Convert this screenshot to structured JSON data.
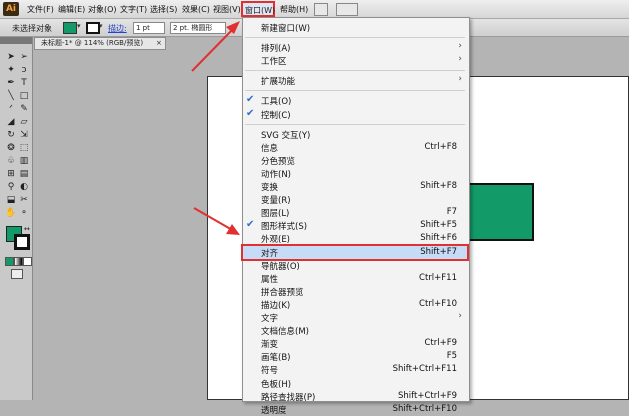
{
  "app": {
    "logo": "Ai"
  },
  "menubar": {
    "items": [
      "文件(F)",
      "编辑(E)",
      "对象(O)",
      "文字(T)",
      "选择(S)",
      "效果(C)",
      "视图(V)",
      "窗口(W)",
      "帮助(H)"
    ]
  },
  "controlbar": {
    "selection_status": "未选择对象",
    "stroke_label": "描边:",
    "stroke_weight": "1 pt",
    "brush": "2 pt. 椭圆形",
    "fill_color": "#139a69",
    "stroke_color": "#111111"
  },
  "document": {
    "tab_title": "未标题-1* @ 114% (RGB/预览)",
    "close_label": "×",
    "object_fill": "#139a69"
  },
  "window_menu": {
    "items": [
      {
        "label": "新建窗口(W)",
        "shortcut": "",
        "submenu": false,
        "checked": false
      },
      {
        "label": "排列(A)",
        "shortcut": "",
        "submenu": true,
        "checked": false
      },
      {
        "label": "工作区",
        "shortcut": "",
        "submenu": true,
        "checked": false
      },
      {
        "label": "扩展功能",
        "shortcut": "",
        "submenu": true,
        "checked": false
      },
      {
        "label": "工具(O)",
        "shortcut": "",
        "submenu": false,
        "checked": true
      },
      {
        "label": "控制(C)",
        "shortcut": "",
        "submenu": false,
        "checked": true
      },
      {
        "label": "SVG 交互(Y)",
        "shortcut": "",
        "submenu": false,
        "checked": false
      },
      {
        "label": "信息",
        "shortcut": "Ctrl+F8",
        "submenu": false,
        "checked": false
      },
      {
        "label": "分色预览",
        "shortcut": "",
        "submenu": false,
        "checked": false
      },
      {
        "label": "动作(N)",
        "shortcut": "",
        "submenu": false,
        "checked": false
      },
      {
        "label": "变换",
        "shortcut": "Shift+F8",
        "submenu": false,
        "checked": false
      },
      {
        "label": "变量(R)",
        "shortcut": "",
        "submenu": false,
        "checked": false
      },
      {
        "label": "图层(L)",
        "shortcut": "F7",
        "submenu": false,
        "checked": false
      },
      {
        "label": "图形样式(S)",
        "shortcut": "Shift+F5",
        "submenu": false,
        "checked": true
      },
      {
        "label": "外观(E)",
        "shortcut": "Shift+F6",
        "submenu": false,
        "checked": false
      },
      {
        "label": "对齐",
        "shortcut": "Shift+F7",
        "submenu": false,
        "checked": false,
        "highlighted": true
      },
      {
        "label": "导航器(O)",
        "shortcut": "",
        "submenu": false,
        "checked": false
      },
      {
        "label": "属性",
        "shortcut": "Ctrl+F11",
        "submenu": false,
        "checked": false
      },
      {
        "label": "拼合器预览",
        "shortcut": "",
        "submenu": false,
        "checked": false
      },
      {
        "label": "描边(K)",
        "shortcut": "Ctrl+F10",
        "submenu": false,
        "checked": false
      },
      {
        "label": "文字",
        "shortcut": "",
        "submenu": true,
        "checked": false
      },
      {
        "label": "文档信息(M)",
        "shortcut": "",
        "submenu": false,
        "checked": false
      },
      {
        "label": "渐变",
        "shortcut": "Ctrl+F9",
        "submenu": false,
        "checked": false
      },
      {
        "label": "画笔(B)",
        "shortcut": "F5",
        "submenu": false,
        "checked": false
      },
      {
        "label": "符号",
        "shortcut": "Shift+Ctrl+F11",
        "submenu": false,
        "checked": false
      },
      {
        "label": "色板(H)",
        "shortcut": "",
        "submenu": false,
        "checked": false
      },
      {
        "label": "路径查找器(P)",
        "shortcut": "Shift+Ctrl+F9",
        "submenu": false,
        "checked": false
      },
      {
        "label": "透明度",
        "shortcut": "Shift+Ctrl+F10",
        "submenu": false,
        "checked": false
      }
    ]
  },
  "tools": [
    "selection-tool",
    "direct-selection-tool",
    "magic-wand-tool",
    "lasso-tool",
    "pen-tool",
    "type-tool",
    "line-tool",
    "rectangle-tool",
    "paintbrush-tool",
    "pencil-tool",
    "blob-brush-tool",
    "eraser-tool",
    "rotate-tool",
    "scale-tool",
    "warp-tool",
    "free-transform-tool",
    "symbol-sprayer-tool",
    "column-graph-tool",
    "mesh-tool",
    "gradient-tool",
    "eyedropper-tool",
    "blend-tool",
    "live-paint-tool",
    "slice-tool",
    "hand-tool",
    "zoom-tool"
  ],
  "colors": {
    "accent_highlight": "#c6dcf6",
    "annotation_red": "#e03030"
  }
}
